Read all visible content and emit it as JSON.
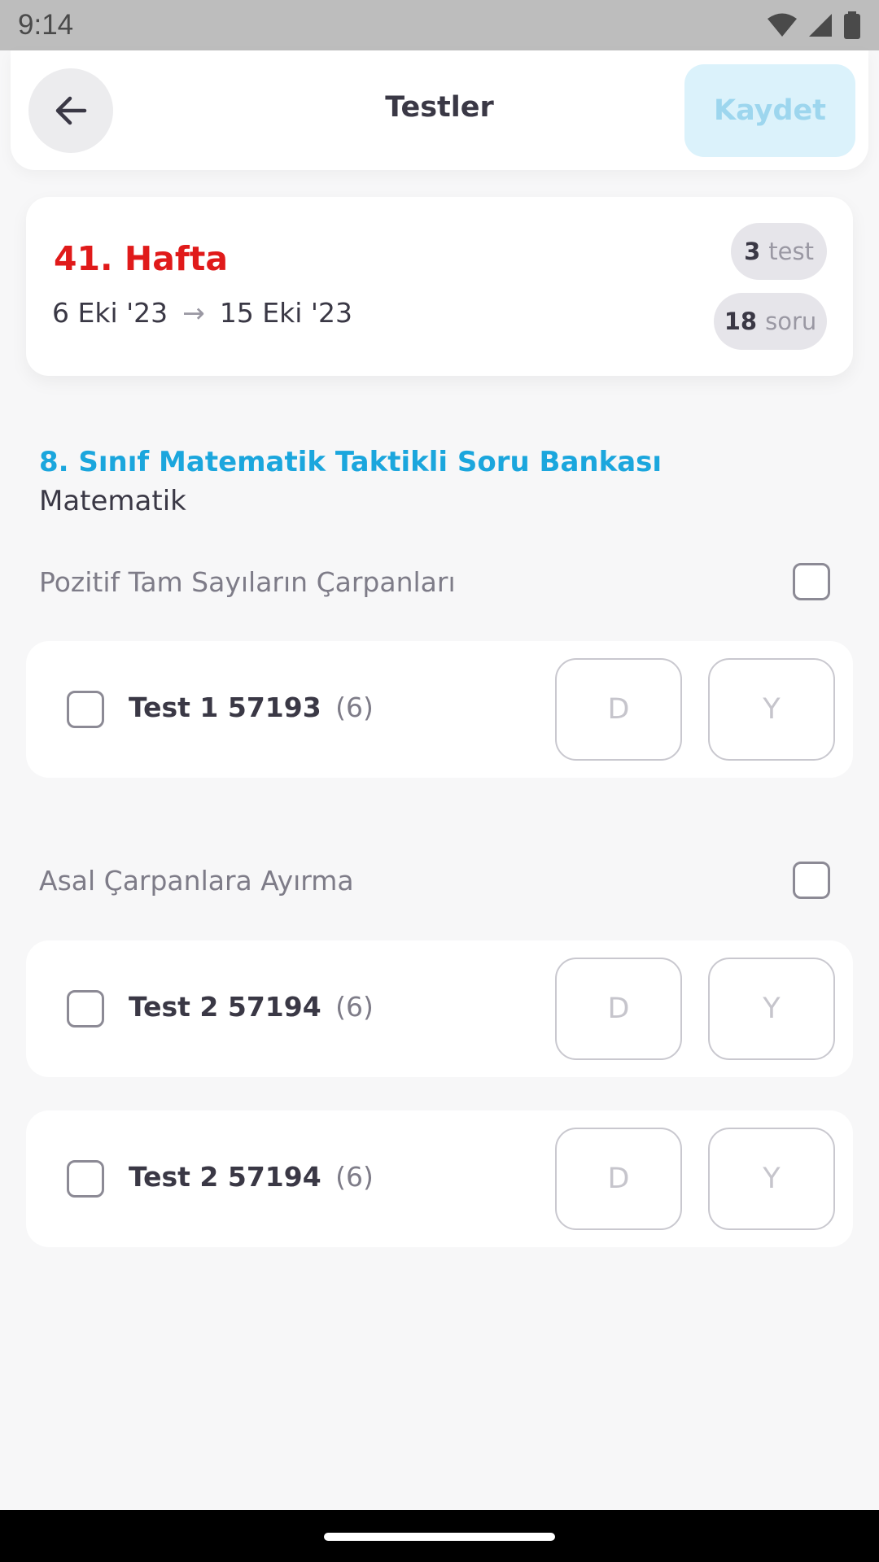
{
  "status_bar": {
    "time": "9:14",
    "icons": [
      "wifi-icon",
      "signal-icon",
      "battery-icon"
    ]
  },
  "header": {
    "back_icon": "arrow-left-icon",
    "title": "Testler",
    "save_label": "Kaydet"
  },
  "week": {
    "title": "41. Hafta",
    "start": "6 Eki '23",
    "arrow": "→",
    "end": "15 Eki '23",
    "test_count": "3",
    "test_unit": "test",
    "question_count": "18",
    "question_unit": "soru"
  },
  "book": {
    "title": "8. Sınıf Matematik Taktikli Soru Bankası",
    "subject": "Matematik"
  },
  "topics": [
    {
      "label": "Pozitif Tam Sayıların Çarpanları",
      "tests": [
        {
          "name": "Test 1 57193",
          "count": "(6)",
          "correct_label": "D",
          "wrong_label": "Y"
        }
      ]
    },
    {
      "label": "Asal Çarpanlara Ayırma",
      "tests": [
        {
          "name": "Test 2 57194",
          "count": "(6)",
          "correct_label": "D",
          "wrong_label": "Y"
        },
        {
          "name": "Test 2 57194",
          "count": "(6)",
          "correct_label": "D",
          "wrong_label": "Y"
        }
      ]
    }
  ],
  "colors": {
    "accent_red": "#e01a1a",
    "accent_blue": "#1ba6dd",
    "save_bg": "#dbf2fb",
    "save_text": "#9dd6ee"
  }
}
